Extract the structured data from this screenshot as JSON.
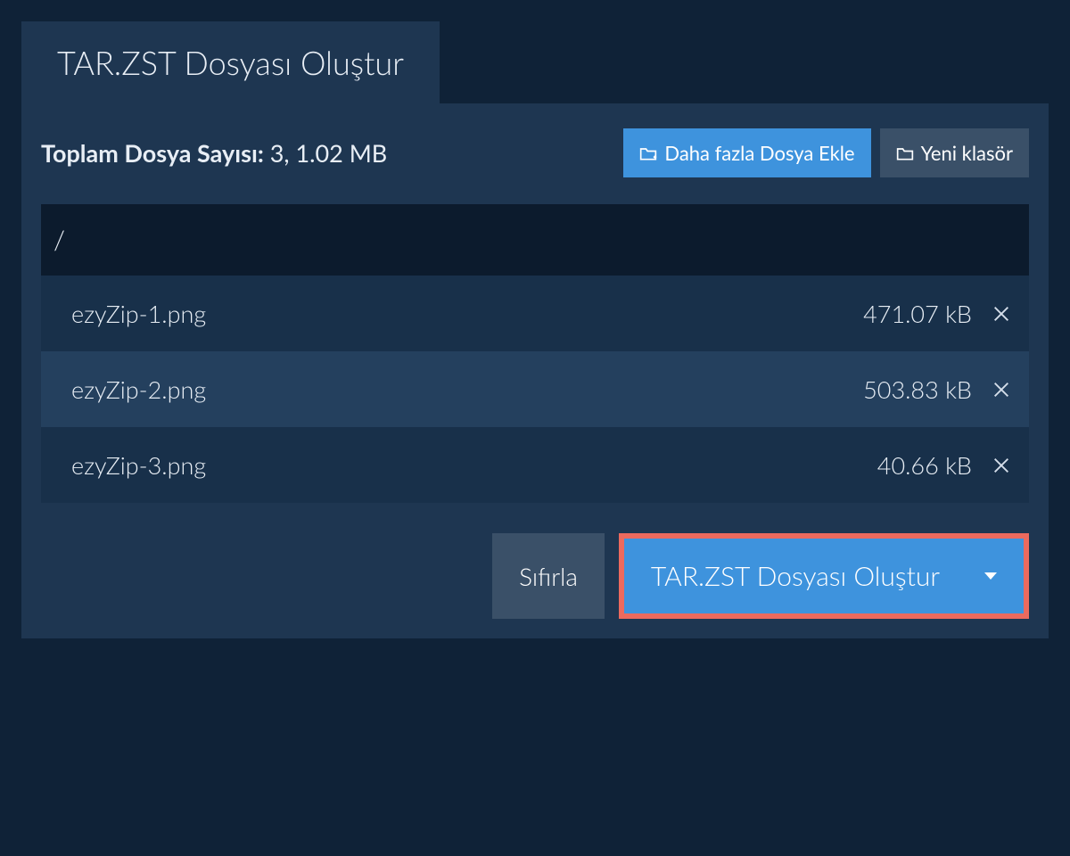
{
  "tab_title": "TAR.ZST Dosyası Oluştur",
  "summary": {
    "label": "Toplam Dosya Sayısı:",
    "value": "3, 1.02 MB"
  },
  "buttons": {
    "add_files": "Daha fazla Dosya Ekle",
    "new_folder": "Yeni klasör",
    "reset": "Sıfırla",
    "create": "TAR.ZST Dosyası Oluştur"
  },
  "breadcrumb": "/",
  "files": [
    {
      "name": "ezyZip-1.png",
      "size": "471.07 kB"
    },
    {
      "name": "ezyZip-2.png",
      "size": "503.83 kB"
    },
    {
      "name": "ezyZip-3.png",
      "size": "40.66 kB"
    }
  ],
  "colors": {
    "accent_blue": "#3e93dd",
    "highlight_red": "#ec6a5e",
    "panel_bg": "#1e3651",
    "page_bg": "#0f2237"
  }
}
